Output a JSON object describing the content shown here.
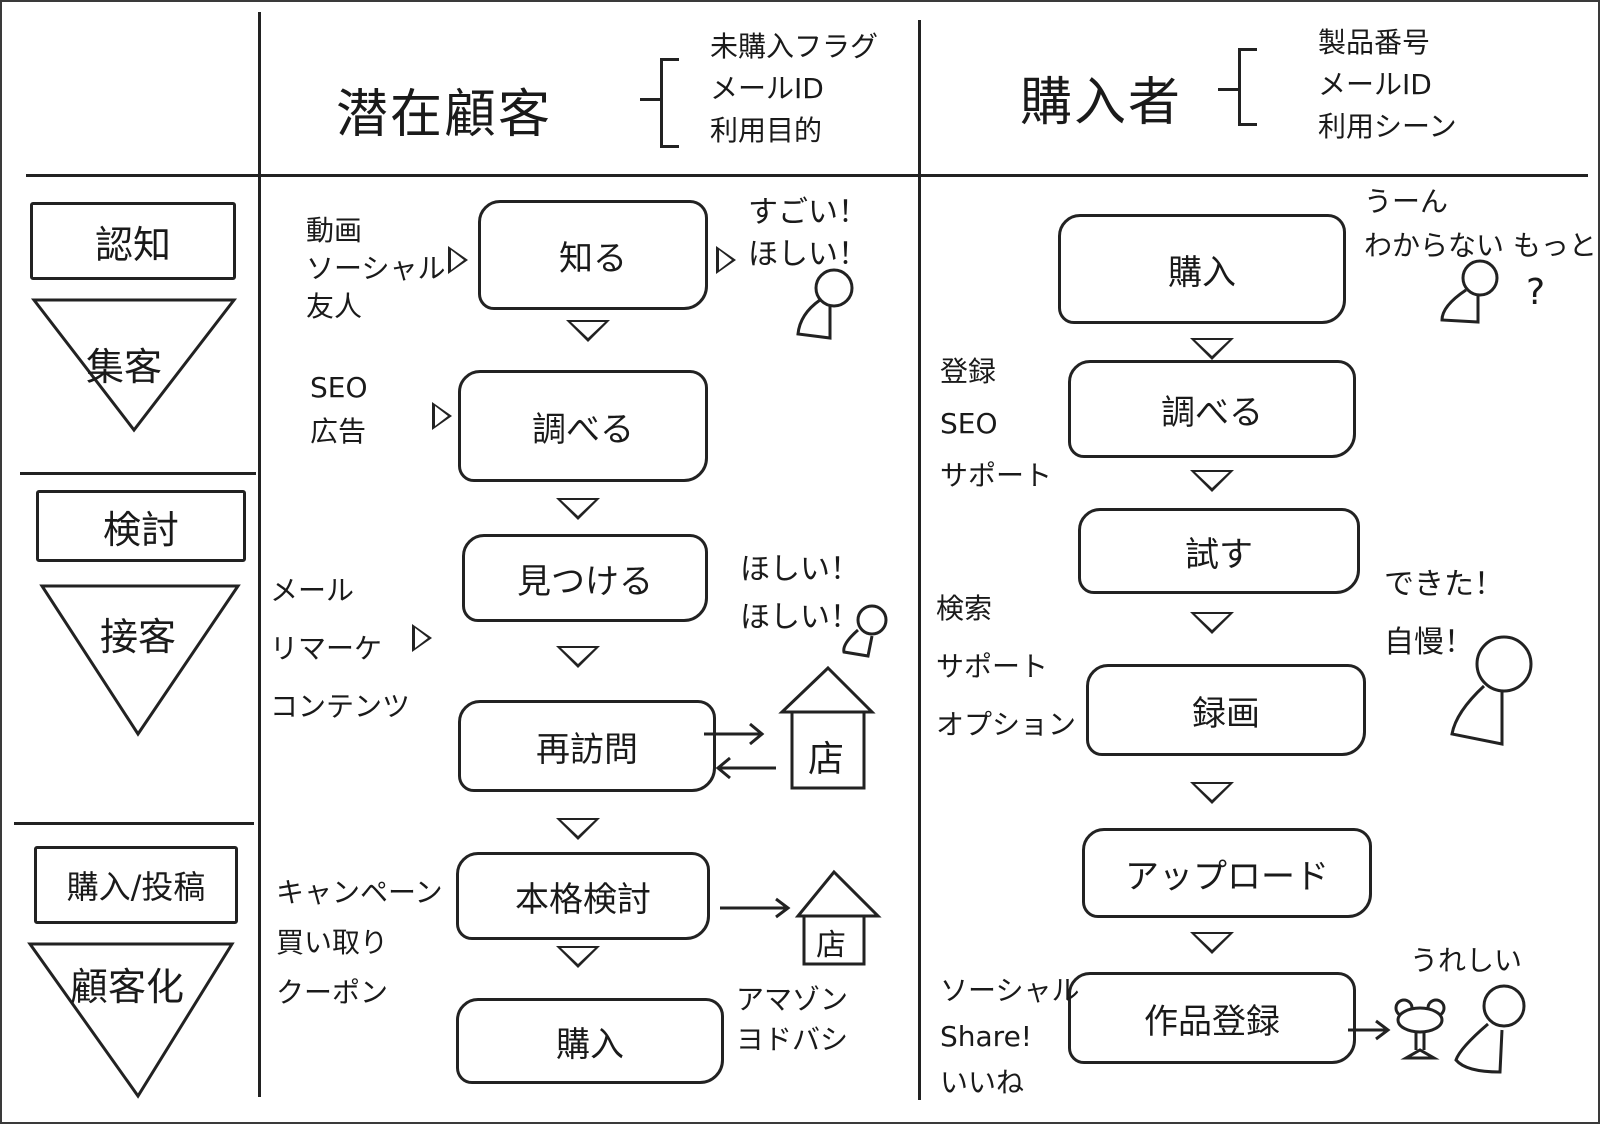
{
  "columns": {
    "prospect": {
      "title": "潜在顧客",
      "attributes": [
        "未購入フラグ",
        "メールID",
        "利用目的"
      ]
    },
    "buyer": {
      "title": "購入者",
      "attributes": [
        "製品番号",
        "メールID",
        "利用シーン"
      ]
    }
  },
  "stages": [
    {
      "label": "認知",
      "funnel": "集客"
    },
    {
      "label": "検討",
      "funnel": "接客"
    },
    {
      "label": "購入/投稿",
      "funnel": "顧客化"
    }
  ],
  "prospect_flow": {
    "steps": [
      "知る",
      "調べる",
      "見つける",
      "再訪問",
      "本格検討",
      "購入"
    ],
    "channels": [
      "動画\nソーシャル\n友人",
      "SEO\n広告",
      "メール\nリマーケ\nコンテンツ",
      "キャンペーン\n買い取り\nクーポン"
    ],
    "reactions": {
      "know": "すごい！\nほしい！",
      "find": "ほしい！\nほしい！",
      "store_label": "店",
      "retailers": "アマゾン\nヨドバシ"
    }
  },
  "buyer_flow": {
    "steps": [
      "購入",
      "調べる",
      "試す",
      "録画",
      "アップロード",
      "作品登録"
    ],
    "channels": [
      "登録\nSEO\nサポート",
      "検索\nサポート\nオプション",
      "ソーシャル\nShare!\nいいね"
    ],
    "reactions": {
      "purchase": "うーん\nわからない もっと",
      "question_mark": "?",
      "record": "できた！\n自慢！",
      "register": "うれしい"
    }
  }
}
